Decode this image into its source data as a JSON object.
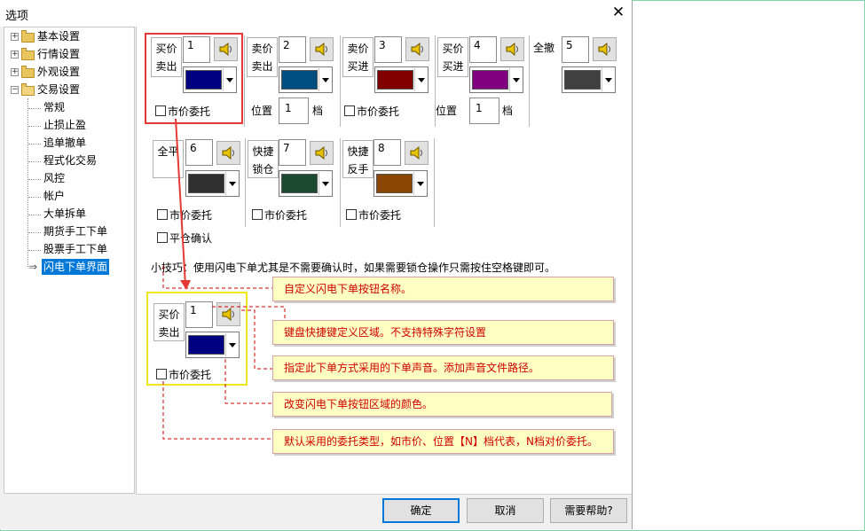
{
  "window": {
    "title": "选项",
    "close_glyph": "✕"
  },
  "tree": {
    "top": [
      {
        "label": "基本设置",
        "expander": "+"
      },
      {
        "label": "行情设置",
        "expander": "+"
      },
      {
        "label": "外观设置",
        "expander": "+"
      },
      {
        "label": "交易设置",
        "expander": "−"
      }
    ],
    "children": [
      "常规",
      "止损止盈",
      "追单撤单",
      "程式化交易",
      "风控",
      "帐户",
      "大单拆单",
      "期货手工下单",
      "股票手工下单",
      "闪电下单界面"
    ],
    "selected_arrow": "⇒"
  },
  "buttons_row1": [
    {
      "label_line1": "买价",
      "label_line2": "卖出",
      "hotkey": "1",
      "color": "#000080",
      "market_order_label": "市价委托",
      "has_market_order": true
    },
    {
      "label_line1": "卖价",
      "label_line2": "卖出",
      "hotkey": "2",
      "color": "#004f80",
      "position_label": "位置",
      "position_value": "1",
      "unit": "档"
    },
    {
      "label_line1": "卖价",
      "label_line2": "买进",
      "hotkey": "3",
      "color": "#800000",
      "market_order_label": "市价委托",
      "has_market_order": true
    },
    {
      "label_line1": "买价",
      "label_line2": "买进",
      "hotkey": "4",
      "color": "#800080",
      "position_label": "位置",
      "position_value": "1",
      "unit": "档"
    },
    {
      "label_line1": "全撤",
      "label_line2": "",
      "hotkey": "5",
      "color": "#404040"
    }
  ],
  "buttons_row2": [
    {
      "label_line1": "全平",
      "label_line2": "",
      "hotkey": "6",
      "color": "#303030",
      "market_order_label": "市价委托",
      "confirm_label": "平仓确认"
    },
    {
      "label_line1": "快捷",
      "label_line2": "锁仓",
      "hotkey": "7",
      "color": "#1c4a2e",
      "market_order_label": "市价委托"
    },
    {
      "label_line1": "快捷",
      "label_line2": "反手",
      "hotkey": "8",
      "color": "#8a4500",
      "market_order_label": "市价委托"
    }
  ],
  "tip": "小技巧：使用闪电下单尤其是不需要确认时，如果需要锁仓操作只需按住空格键即可。",
  "example": {
    "label_line1": "买价",
    "label_line2": "卖出",
    "hotkey": "1",
    "color": "#000080",
    "market_order_label": "市价委托"
  },
  "annotations": [
    "自定义闪电下单按钮名称。",
    "键盘快捷键定义区域。不支持特殊字符设置",
    "指定此下单方式采用的下单声音。添加声音文件路径。",
    "改变闪电下单按钮区域的颜色。",
    "默认采用的委托类型，如市价、位置【N】档代表，N档对价委托。"
  ],
  "footer": {
    "ok": "确定",
    "cancel": "取消",
    "help": "需要帮助?"
  },
  "colors": {
    "red_highlight": "#e53935",
    "yellow_highlight": "#f2e51c",
    "annotation_text": "#d00000",
    "selection": "#0078d7"
  }
}
